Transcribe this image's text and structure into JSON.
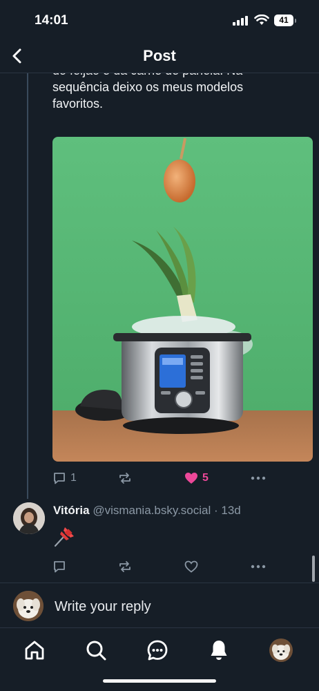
{
  "status_bar": {
    "time": "14:01",
    "battery": "41"
  },
  "header": {
    "title": "Post"
  },
  "post": {
    "text": "do feijão e da carne de panela. Na\nsequência deixo os meus modelos\nfavoritos.",
    "actions": {
      "replies": "1",
      "likes": "5"
    }
  },
  "reply": {
    "display_name": "Vitória",
    "handle": "@vismania.bsky.social",
    "separator": " · ",
    "age": "13d",
    "content": "📌"
  },
  "composer": {
    "placeholder": "Write your reply"
  },
  "colors": {
    "accent_like": "#ec4899",
    "background": "#161e27",
    "muted": "#8b98a5"
  },
  "icons": [
    "back-chevron-icon",
    "reply-icon",
    "repost-icon",
    "heart-icon",
    "more-icon",
    "home-icon",
    "search-icon",
    "chat-icon",
    "bell-icon"
  ]
}
